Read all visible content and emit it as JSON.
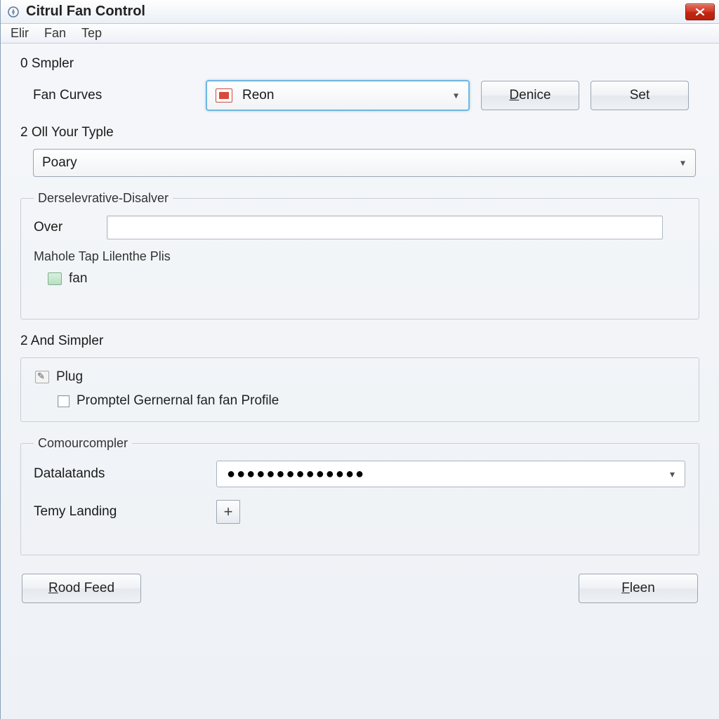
{
  "titlebar": {
    "app_title": "Citrul Fan Control"
  },
  "menu": {
    "item1": "Elir",
    "item2": "Fan",
    "item3": "Tep"
  },
  "section0": {
    "label": "0 Smpler",
    "fan_curves_label": "Fan Curves",
    "dropdown_value": "Reon",
    "denice_button": "Denice",
    "set_button": "Set"
  },
  "section2a": {
    "label": "2 Oll Your Typle",
    "dropdown_value": "Poary"
  },
  "group1": {
    "legend": "Derselevrative-Disalver",
    "over_label": "Over",
    "subgroup_label": "Mahole Tap Lilenthe Plis",
    "fan_item": "fan"
  },
  "section2b": {
    "label": "2 And Simpler",
    "plug_item": "Plug",
    "checkbox_label": "Promptel Gernernal fan fan Profile"
  },
  "group2": {
    "legend": "Comourcompler",
    "datalatands_label": "Datalatands",
    "datalatands_value": "●●●●●●●●●●●●●●",
    "temy_label": "Temy Landing"
  },
  "footer": {
    "rood_feed": "Rood Feed",
    "fleen": "Fleen"
  }
}
